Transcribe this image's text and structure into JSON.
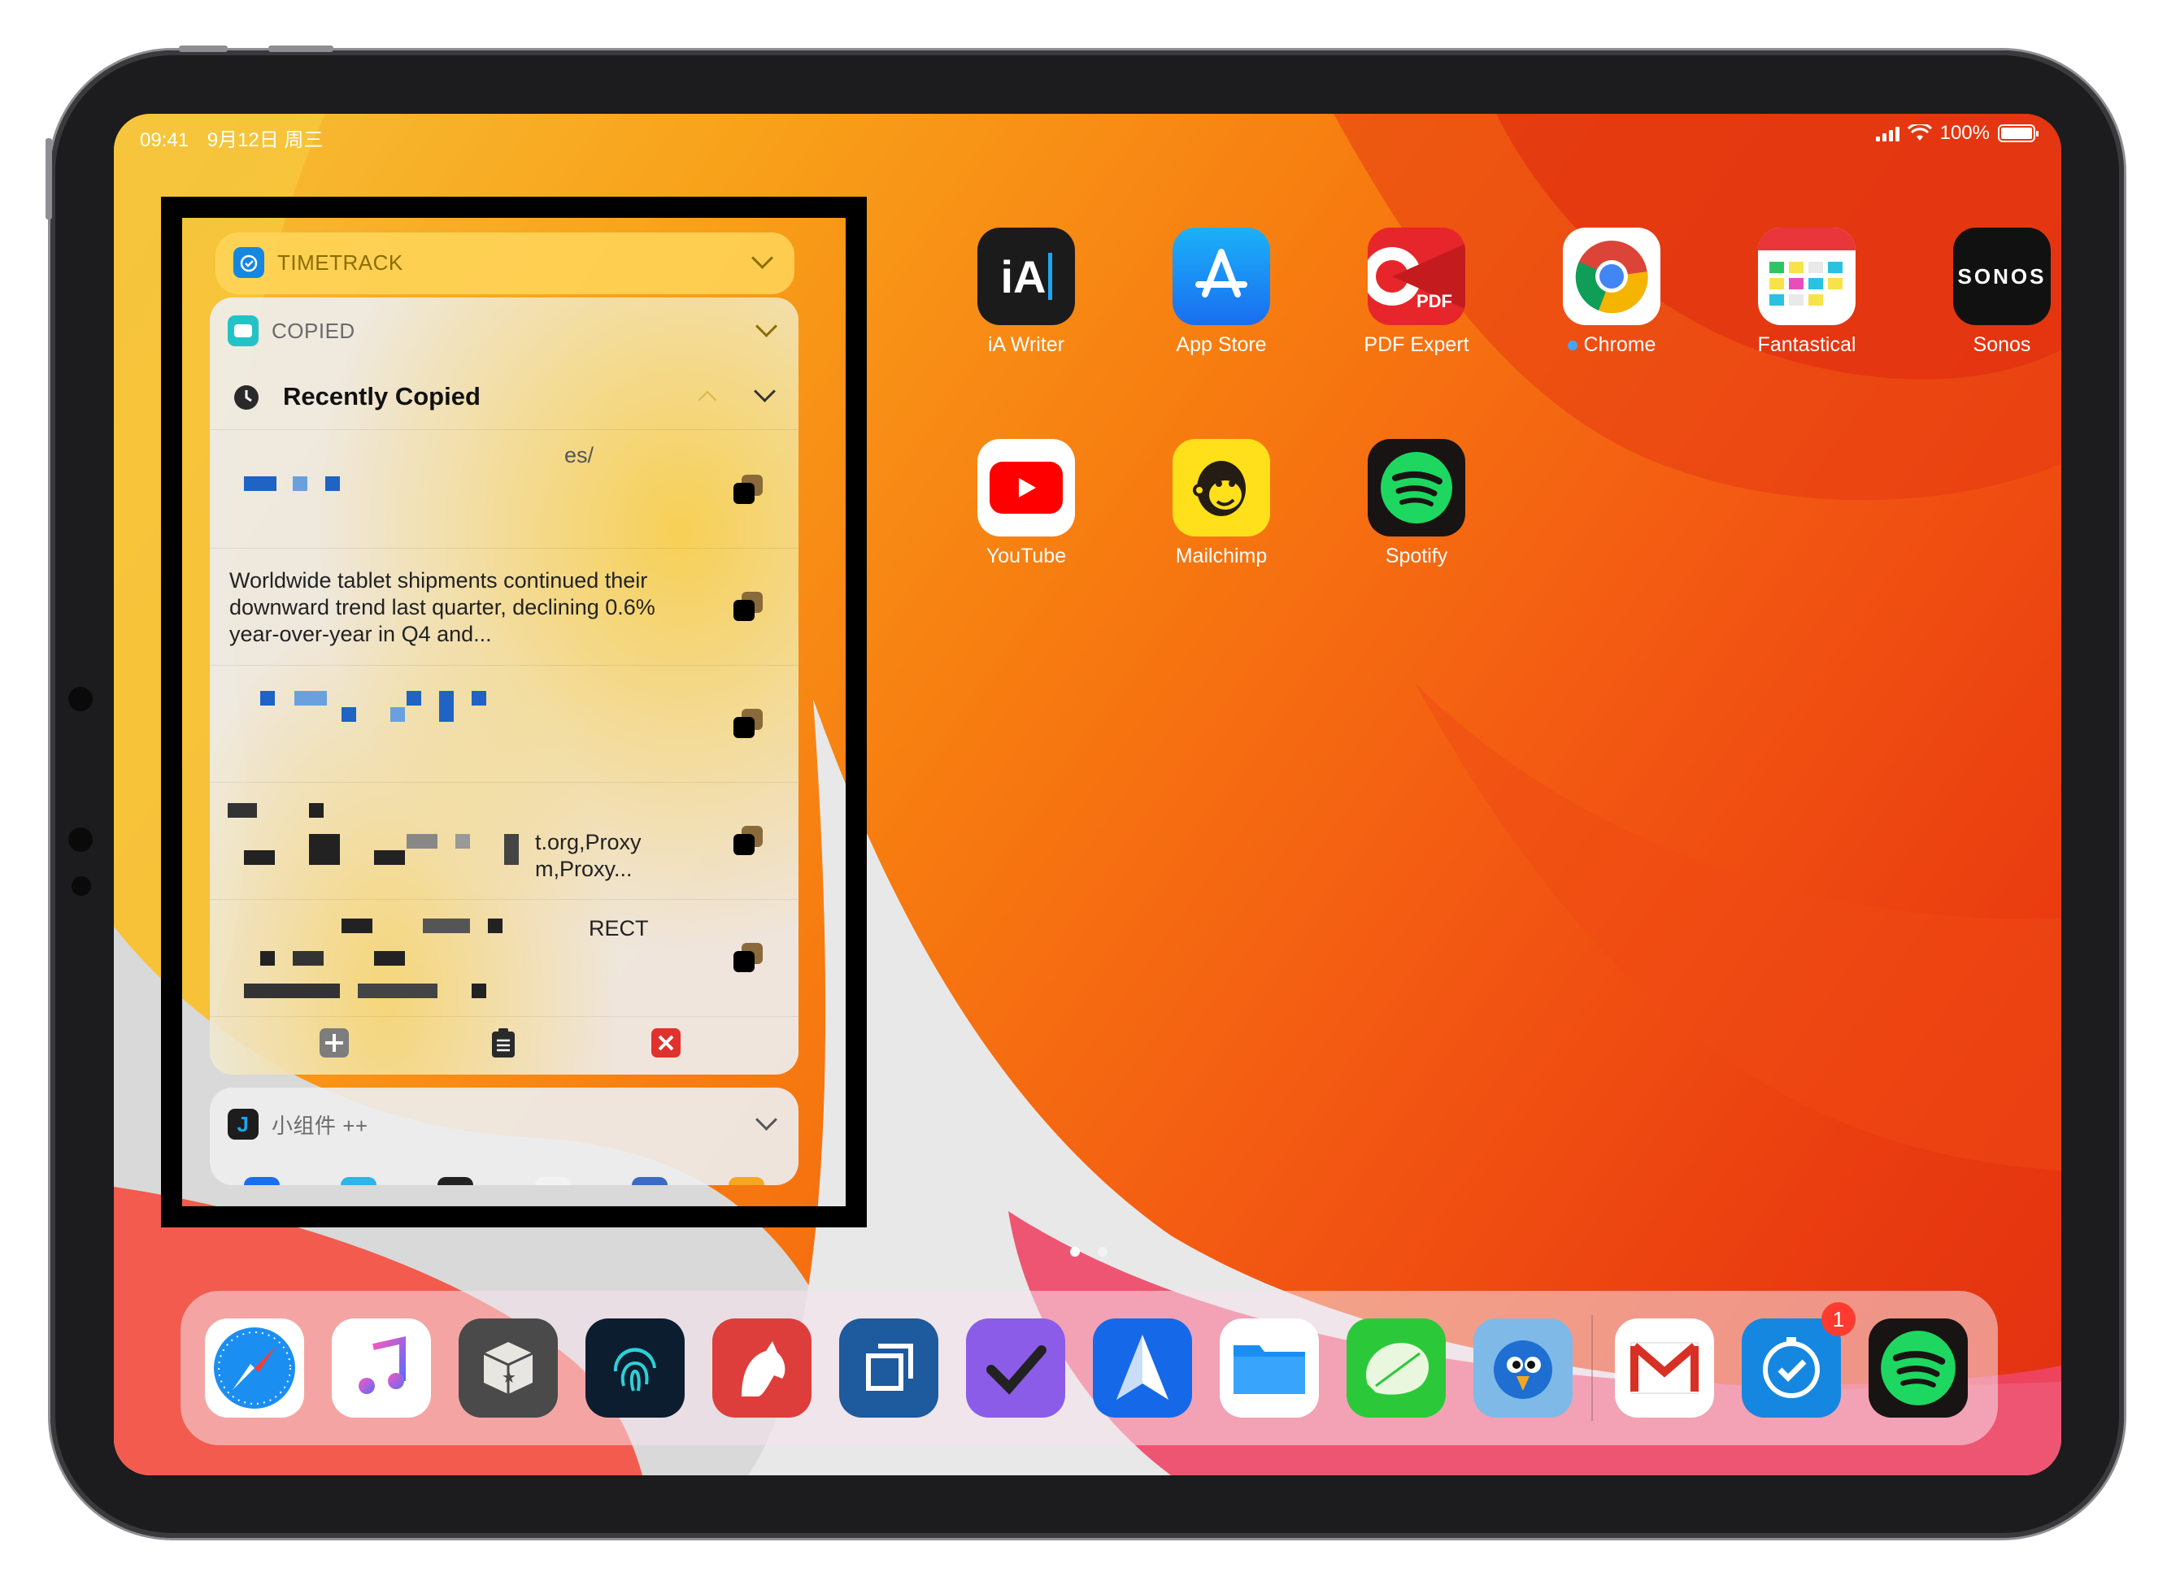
{
  "status_bar": {
    "time": "09:41",
    "date": "9月12日 周三",
    "battery": "100%"
  },
  "home_apps": [
    {
      "label": "iA Writer",
      "icon": "ia-writer-icon"
    },
    {
      "label": "App Store",
      "icon": "app-store-icon"
    },
    {
      "label": "PDF Expert",
      "icon": "pdf-expert-icon"
    },
    {
      "label": "Chrome",
      "icon": "chrome-icon",
      "new_dot": true
    },
    {
      "label": "Fantastical",
      "icon": "fantastical-icon"
    },
    {
      "label": "Sonos",
      "icon": "sonos-icon"
    },
    {
      "label": "YouTube",
      "icon": "youtube-icon"
    },
    {
      "label": "Mailchimp",
      "icon": "mailchimp-icon"
    },
    {
      "label": "Spotify",
      "icon": "spotify-icon"
    }
  ],
  "icon_text": {
    "ia": "iA",
    "sonos": "SONOS",
    "pdf": "PDF",
    "mailchimp_face": "🐵"
  },
  "widgets": {
    "timetrack": {
      "title": "TIMETRACK"
    },
    "copied": {
      "title": "COPIED",
      "section": "Recently Copied",
      "items": [
        {
          "text": "es/"
        },
        {
          "text": "Worldwide tablet shipments continued their downward trend last quarter, declining 0.6% year-over-year in Q4 and..."
        },
        {
          "text": ""
        },
        {
          "text": "t.org,Proxy\nm,Proxy..."
        },
        {
          "text": "RECT"
        }
      ]
    },
    "xiaozujian": {
      "title": "小组件 ++"
    }
  },
  "dock": {
    "apps": [
      "safari-icon",
      "music-icon",
      "bundle-icon",
      "fingerprint-icon",
      "bear-icon",
      "screens-icon",
      "omnifocus-icon",
      "spark-icon",
      "files-icon",
      "messages-icon",
      "tweetbot-icon",
      "gmail-icon",
      "timetrack-icon",
      "spotify-icon"
    ],
    "badge": "1"
  },
  "colors": {
    "accent": "#f77b10",
    "highlight_frame": "#000000"
  }
}
